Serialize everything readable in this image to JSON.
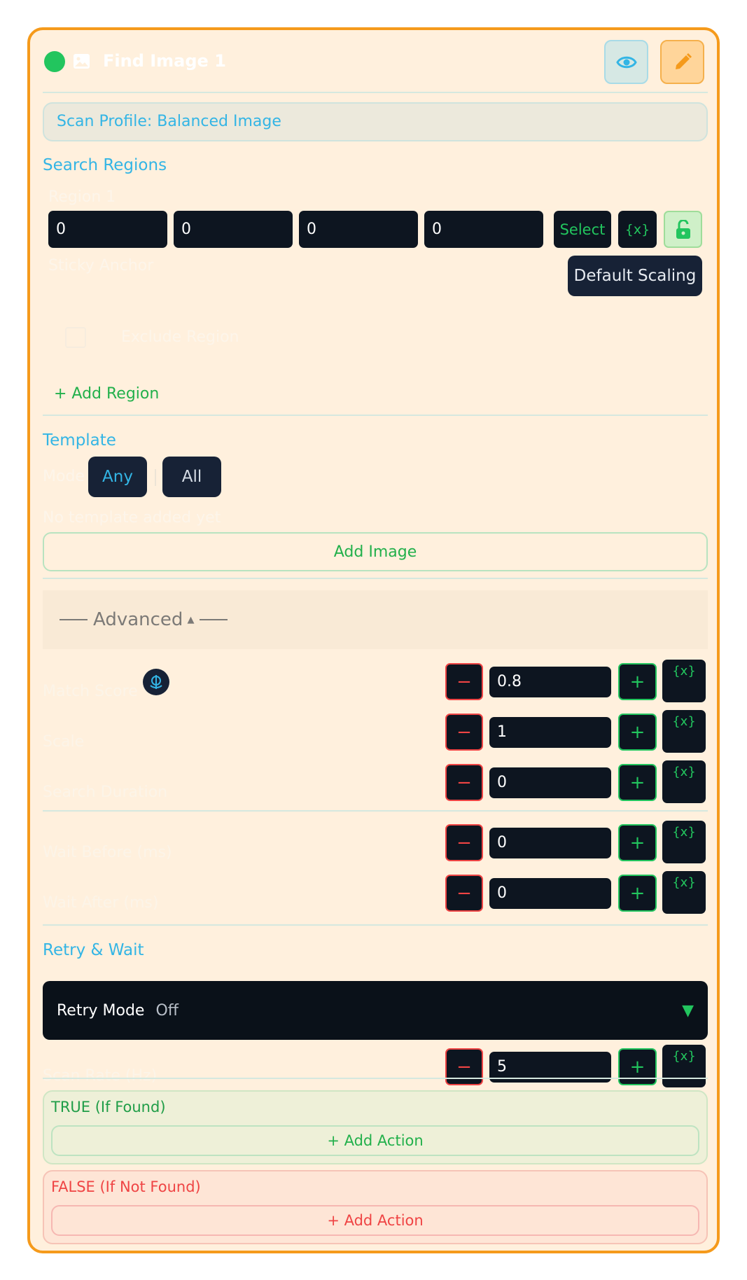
{
  "header": {
    "title": "Find Image 1",
    "status_color": "#22c55e",
    "icons": [
      "image-icon",
      "eye-icon",
      "pencil-icon"
    ]
  },
  "scan_profile": "Scan Profile: Balanced Image",
  "search_regions": {
    "label": "Search Regions",
    "region_title": "Region 1",
    "coords": [
      "0",
      "0",
      "0",
      "0"
    ],
    "select_label": "Select",
    "variable_label": "{x}",
    "sticky_anchor_label": "Sticky Anchor",
    "scaling_label": "Default Scaling",
    "exclude_label": "Exclude Region",
    "add_region_label": "+ Add Region"
  },
  "template": {
    "label": "Template",
    "mode_label": "Mode",
    "modes": [
      "Any",
      "All"
    ],
    "selected_mode": "Any",
    "empty_text": "No template added yet",
    "add_image_label": "Add Image"
  },
  "advanced": {
    "label": "Advanced",
    "rows": [
      {
        "label": "Match Score",
        "value": "0.8"
      },
      {
        "label": "Scale",
        "value": "1"
      },
      {
        "label": "Search Duration",
        "value": "0"
      },
      {
        "label": "Wait Before (ms)",
        "value": "0"
      },
      {
        "label": "Wait After (ms)",
        "value": "0"
      }
    ],
    "minus": "−",
    "plus": "+",
    "variable": "{x}"
  },
  "retry": {
    "label": "Retry & Wait",
    "mode_label": "Retry Mode",
    "mode_value": "Off",
    "scan_rate_label": "Scan Rate (Hz)",
    "scan_rate_value": "5"
  },
  "branches": {
    "true_label": "TRUE (If Found)",
    "false_label": "FALSE (If Not Found)",
    "add_action_label": "+ Add Action"
  },
  "colors": {
    "accent_orange": "#f59a1b",
    "accent_blue": "#33b5e5",
    "accent_green": "#22c55e",
    "danger_red": "#ef4444",
    "dark_input": "#0d1520"
  }
}
